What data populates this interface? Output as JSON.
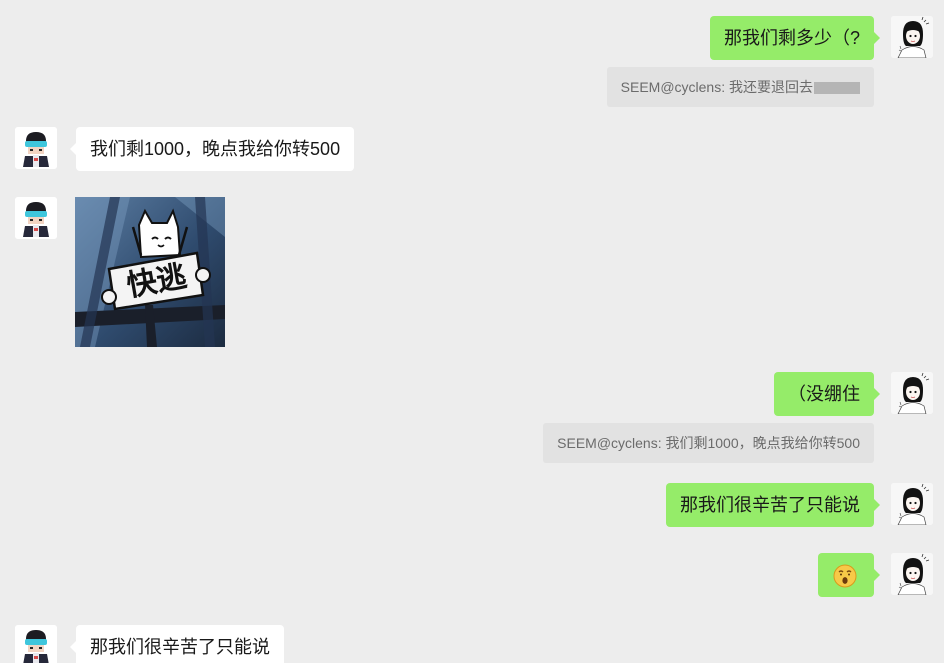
{
  "messages": {
    "m1": {
      "text": "那我们剩多少（?"
    },
    "q1": {
      "text": "SEEM@cyclens: 我还要退回去"
    },
    "m2": {
      "text": "我们剩1000，晚点我给你转500"
    },
    "m3": {
      "sticker_text": "快逃",
      "sticker_icon": "cat-holding-sign-sticker"
    },
    "m4": {
      "text": "（没绷住"
    },
    "q2": {
      "text": "SEEM@cyclens: 我们剩1000，晚点我给你转500"
    },
    "m5": {
      "text": "那我们很辛苦了只能说"
    },
    "m6": {
      "emoji_icon": "shocked-face-emoji"
    },
    "m7": {
      "text": "那我们很辛苦了只能说"
    }
  },
  "colors": {
    "background": "#ededed",
    "self_bubble": "#95ec69",
    "other_bubble": "#ffffff",
    "quote_bubble": "#e2e2e2"
  }
}
